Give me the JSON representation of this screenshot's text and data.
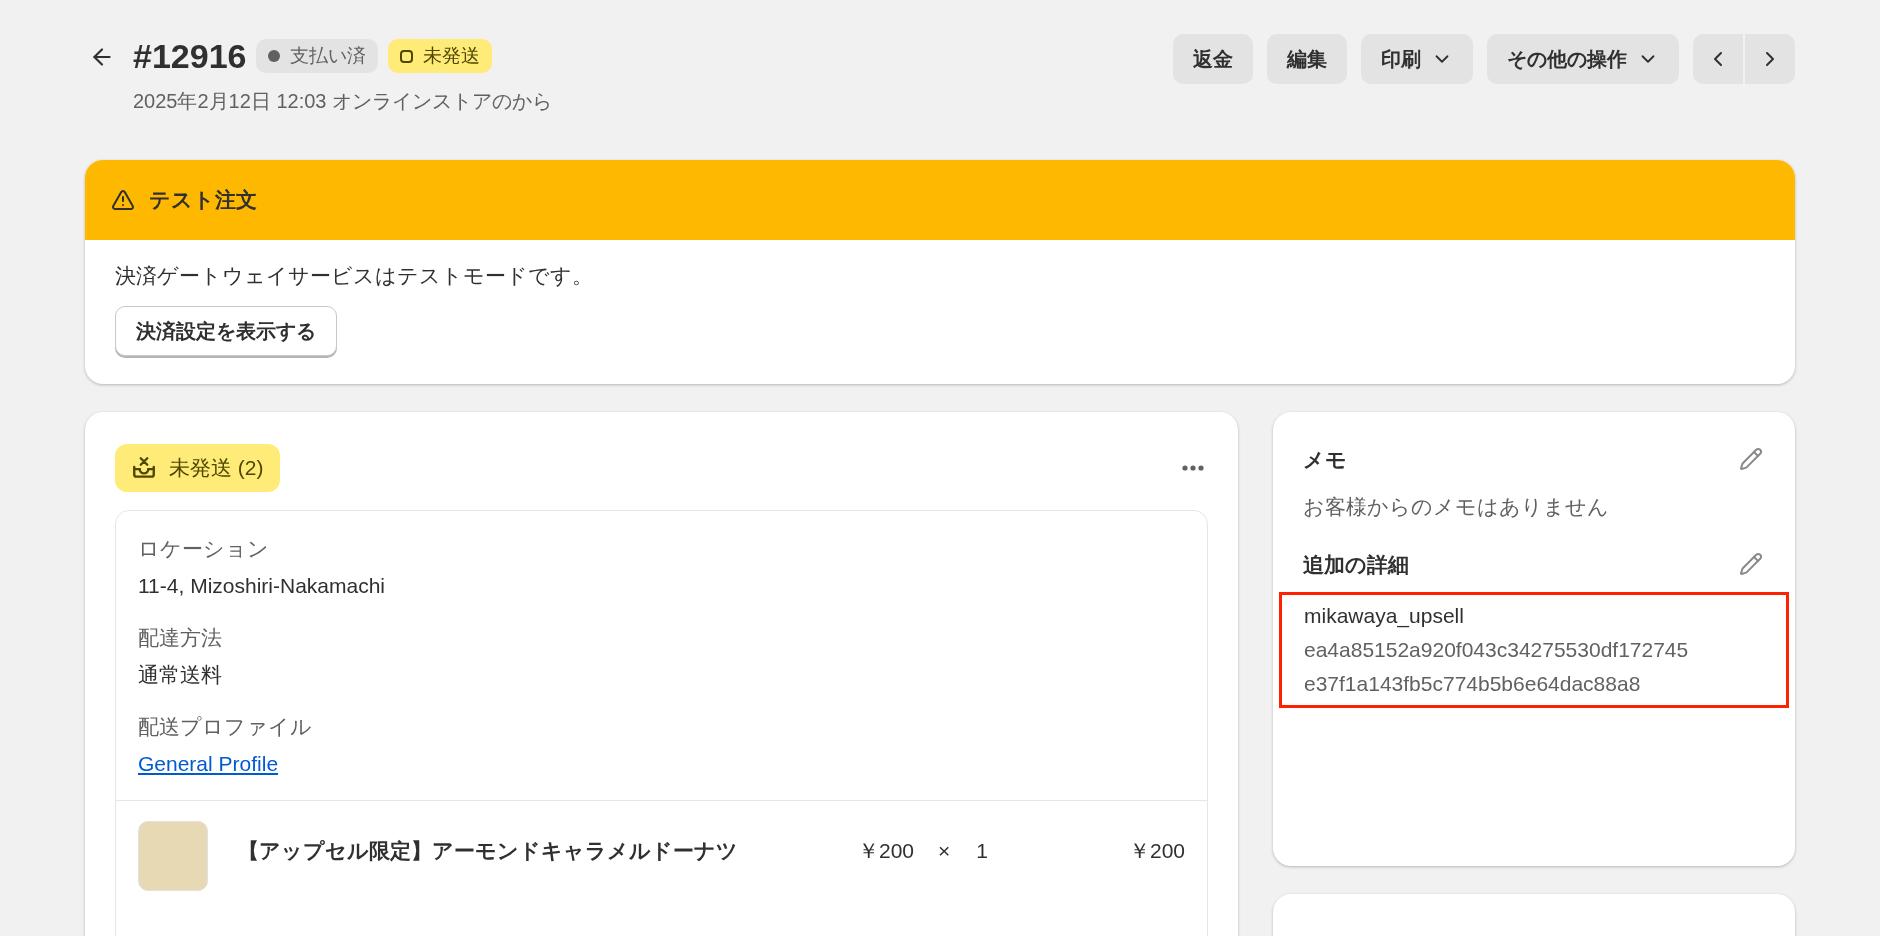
{
  "header": {
    "title": "#12916",
    "subtitle": "2025年2月12日 12:03 オンラインストアのから",
    "badges": [
      {
        "label": "支払い済",
        "kind": "paid"
      },
      {
        "label": "未発送",
        "kind": "unfulfilled"
      }
    ],
    "actions": [
      {
        "label": "返金",
        "dropdown": false
      },
      {
        "label": "編集",
        "dropdown": false
      },
      {
        "label": "印刷",
        "dropdown": true
      },
      {
        "label": "その他の操作",
        "dropdown": true
      }
    ]
  },
  "banner": {
    "title": "テスト注文",
    "message": "決済ゲートウェイサービスはテストモードです。",
    "button": "決済設定を表示する"
  },
  "fulfillment": {
    "status": "未発送 (2)",
    "fields": [
      {
        "label": "ロケーション",
        "value": "11-4, Mizoshiri-Nakamachi",
        "kind": "text"
      },
      {
        "label": "配達方法",
        "value": "通常送料",
        "kind": "text"
      },
      {
        "label": "配送プロファイル",
        "value": "General Profile",
        "kind": "link"
      }
    ],
    "items": [
      {
        "name": "【アップセル限定】アーモンドキャラメルドーナツ",
        "price": "￥200",
        "times": "×",
        "quantity": "1",
        "total": "￥200"
      }
    ]
  },
  "notes": {
    "title": "メモ",
    "text": "お客様からのメモはありません",
    "details_title": "追加の詳細",
    "details": {
      "highlighted": true,
      "key": "mikawaya_upsell",
      "value_lines": [
        "ea4a85152a920f043c34275530df172745",
        "e37f1a143fb5c774b5b6e64dac88a8"
      ]
    }
  }
}
